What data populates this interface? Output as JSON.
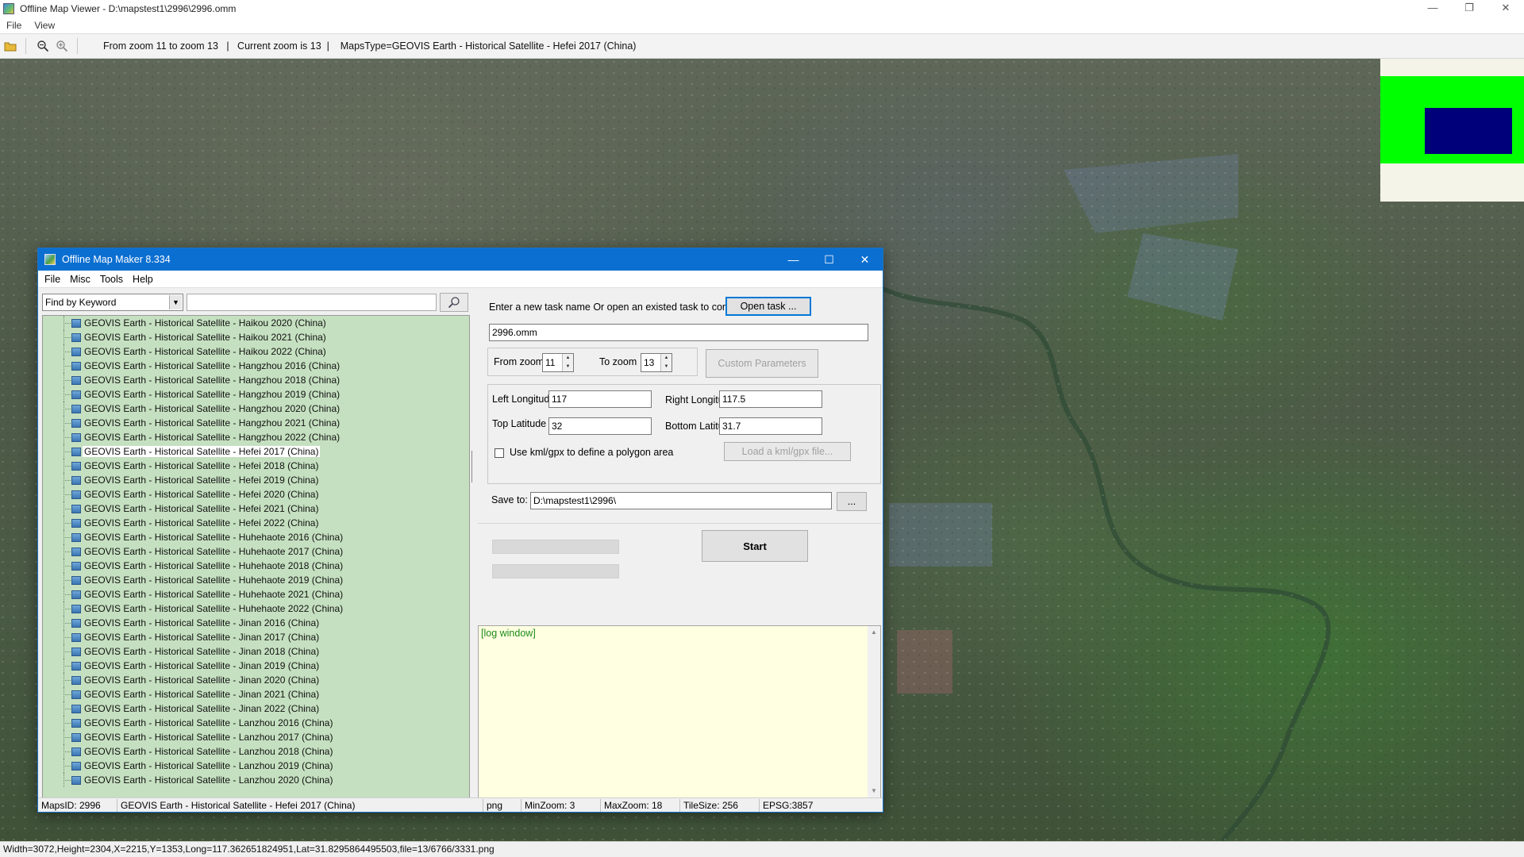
{
  "window": {
    "title": "Offline Map Viewer - D:\\mapstest1\\2996\\2996.omm",
    "controls": {
      "minimize": "—",
      "maximize": "❐",
      "close": "✕"
    }
  },
  "menubar": {
    "file": "File",
    "view": "View"
  },
  "toolbar": {
    "info": "From zoom 11 to zoom 13   |   Current zoom is 13  |    MapsType=GEOVIS Earth - Historical Satellite - Hefei 2017 (China)"
  },
  "statusbar": {
    "text": "Width=3072,Height=2304,X=2215,Y=1353,Long=117.362651824951,Lat=31.8295864495503,file=13/6766/3331.png"
  },
  "dialog": {
    "title": "Offline Map Maker 8.334",
    "menu": [
      "File",
      "Misc",
      "Tools",
      "Help"
    ],
    "find": {
      "mode": "Find by Keyword",
      "query": ""
    },
    "map_types": [
      "GEOVIS Earth - Historical Satellite - Haikou 2020 (China)",
      "GEOVIS Earth - Historical Satellite - Haikou 2021 (China)",
      "GEOVIS Earth - Historical Satellite - Haikou 2022 (China)",
      "GEOVIS Earth - Historical Satellite - Hangzhou 2016 (China)",
      "GEOVIS Earth - Historical Satellite - Hangzhou 2018 (China)",
      "GEOVIS Earth - Historical Satellite - Hangzhou 2019 (China)",
      "GEOVIS Earth - Historical Satellite - Hangzhou 2020 (China)",
      "GEOVIS Earth - Historical Satellite - Hangzhou 2021 (China)",
      "GEOVIS Earth - Historical Satellite - Hangzhou 2022 (China)",
      "GEOVIS Earth - Historical Satellite - Hefei 2017 (China)",
      "GEOVIS Earth - Historical Satellite - Hefei 2018 (China)",
      "GEOVIS Earth - Historical Satellite - Hefei 2019 (China)",
      "GEOVIS Earth - Historical Satellite - Hefei 2020 (China)",
      "GEOVIS Earth - Historical Satellite - Hefei 2021 (China)",
      "GEOVIS Earth - Historical Satellite - Hefei 2022 (China)",
      "GEOVIS Earth - Historical Satellite - Huhehaote 2016 (China)",
      "GEOVIS Earth - Historical Satellite - Huhehaote 2017 (China)",
      "GEOVIS Earth - Historical Satellite - Huhehaote 2018 (China)",
      "GEOVIS Earth - Historical Satellite - Huhehaote 2019 (China)",
      "GEOVIS Earth - Historical Satellite - Huhehaote 2021 (China)",
      "GEOVIS Earth - Historical Satellite - Huhehaote 2022 (China)",
      "GEOVIS Earth - Historical Satellite - Jinan 2016 (China)",
      "GEOVIS Earth - Historical Satellite - Jinan 2017 (China)",
      "GEOVIS Earth - Historical Satellite - Jinan 2018 (China)",
      "GEOVIS Earth - Historical Satellite - Jinan 2019 (China)",
      "GEOVIS Earth - Historical Satellite - Jinan 2020 (China)",
      "GEOVIS Earth - Historical Satellite - Jinan 2021 (China)",
      "GEOVIS Earth - Historical Satellite - Jinan 2022 (China)",
      "GEOVIS Earth - Historical Satellite - Lanzhou 2016 (China)",
      "GEOVIS Earth - Historical Satellite - Lanzhou 2017 (China)",
      "GEOVIS Earth - Historical Satellite - Lanzhou 2018 (China)",
      "GEOVIS Earth - Historical Satellite - Lanzhou 2019 (China)",
      "GEOVIS Earth - Historical Satellite - Lanzhou 2020 (China)"
    ],
    "selected_index": 9,
    "task_prompt": "Enter a new task name Or open an existed task to continue:",
    "open_task_label": "Open task ...",
    "task_name": "2996.omm",
    "from_zoom_label": "From zoom",
    "from_zoom": "11",
    "to_zoom_label": "To zoom",
    "to_zoom": "13",
    "custom_params_label": "Custom Parameters",
    "left_lon_label": "Left Longitude",
    "left_lon": "117",
    "right_lon_label": "Right Longitude",
    "right_lon": "117.5",
    "top_lat_label": "Top Latitude",
    "top_lat": "32",
    "bottom_lat_label": "Bottom Latitude",
    "bottom_lat": "31.7",
    "kml_label": "Use kml/gpx to define a polygon area",
    "kml_checked": false,
    "load_kml_label": "Load a kml/gpx file...",
    "save_to_label": "Save to:",
    "save_to": "D:\\mapstest1\\2996\\",
    "browse_label": "...",
    "start_label": "Start",
    "log_text": "[log window]",
    "status": {
      "maps_id": "MapsID: 2996",
      "map_name": "GEOVIS Earth - Historical Satellite - Hefei 2017 (China)",
      "format": "png",
      "min_zoom": "MinZoom: 3",
      "max_zoom": "MaxZoom: 18",
      "tile_size": "TileSize: 256",
      "epsg": "EPSG:3857"
    }
  },
  "colors": {
    "dialog_title_bg": "#0b6fd1",
    "tree_bg": "#c5e0c0",
    "log_bg": "#ffffe1",
    "overview_green": "#00ff00",
    "overview_view": "#00007a"
  }
}
